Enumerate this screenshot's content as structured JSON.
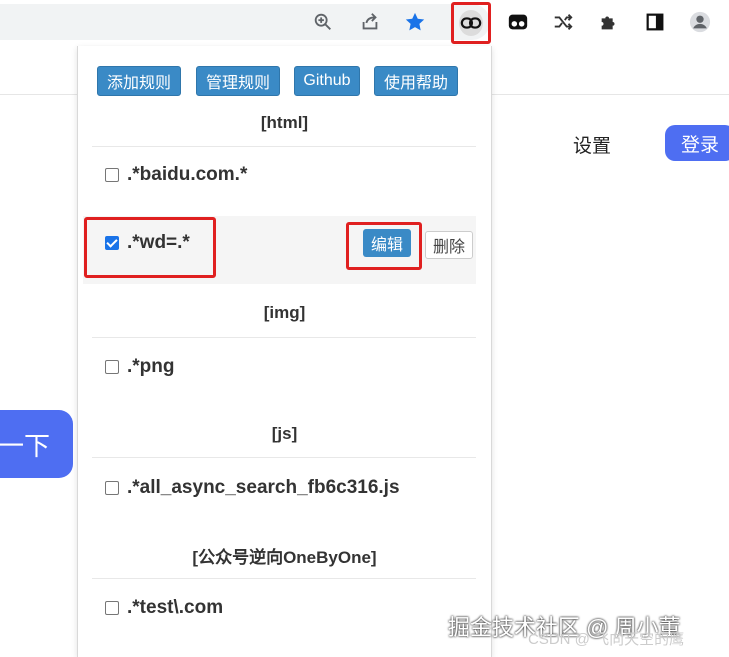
{
  "browser": {
    "toolbar_icons": [
      "zoom-icon",
      "share-icon",
      "bookmark-star-icon",
      "link-extension-icon",
      "tampermonkey-icon",
      "shuffle-extension-icon",
      "puzzle-extensions-icon",
      "side-panel-icon",
      "profile-avatar-icon"
    ],
    "accent_color": "#1a73e8",
    "highlight_color": "#e02020"
  },
  "background_page": {
    "settings_label": "设置",
    "login_label": "登录",
    "search_button_label": "一下"
  },
  "popup": {
    "top_buttons": [
      "添加规则",
      "管理规则",
      "Github",
      "使用帮助"
    ],
    "groups": [
      {
        "title": "[html]",
        "rules": [
          {
            "pattern": ".*baidu.com.*",
            "checked": false
          },
          {
            "pattern": ".*wd=.*",
            "checked": true,
            "edit_label": "编辑",
            "delete_label": "删除"
          }
        ]
      },
      {
        "title": "[img]",
        "rules": [
          {
            "pattern": ".*png",
            "checked": false
          }
        ]
      },
      {
        "title": "[js]",
        "rules": [
          {
            "pattern": ".*all_async_search_fb6c316.js",
            "checked": false
          }
        ]
      },
      {
        "title": "[公众号逆向OneByOne]",
        "rules": [
          {
            "pattern": ".*test\\.com",
            "checked": false
          }
        ]
      }
    ],
    "button_color": "#3a8ac6"
  },
  "watermark": {
    "main": "掘金技术社区 @ 周小董",
    "sub": "CSDN @ 飞向天空的鹰"
  }
}
